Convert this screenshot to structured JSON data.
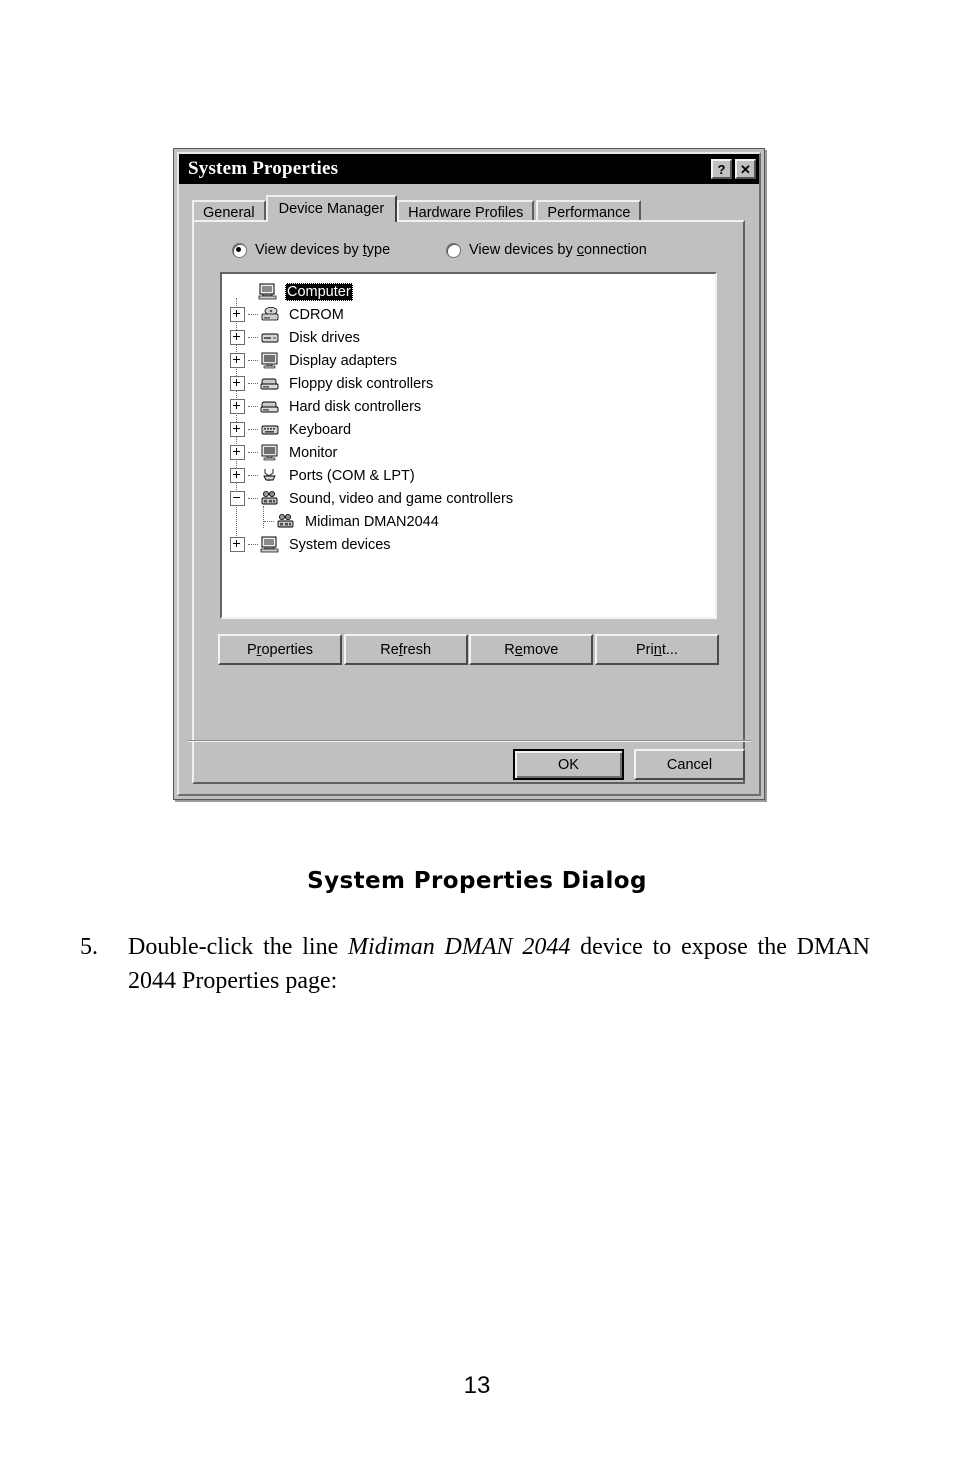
{
  "page": {
    "number": "13",
    "caption": "System Properties Dialog"
  },
  "step": {
    "number": "5.",
    "text_before": "Double-click the line ",
    "text_italic": "Midiman DMAN 2044",
    "text_after": " device to expose the DMAN 2044 Properties page:"
  },
  "dialog": {
    "title": "System Properties",
    "titlebar_buttons": [
      {
        "name": "help-button",
        "glyph": "?"
      },
      {
        "name": "close-button",
        "glyph": "✕"
      }
    ],
    "tabs": [
      {
        "label": "General",
        "active": false
      },
      {
        "label": "Device Manager",
        "active": true
      },
      {
        "label": "Hardware Profiles",
        "active": false
      },
      {
        "label": "Performance",
        "active": false
      }
    ],
    "view_options": [
      {
        "label_prefix": "View devices by ",
        "accel": "t",
        "label_suffix": "ype",
        "checked": true
      },
      {
        "label_prefix": "View devices by ",
        "accel": "c",
        "label_suffix": "onnection",
        "checked": false
      }
    ],
    "tree": [
      {
        "label": "Computer",
        "icon": "computer-icon",
        "state": "none",
        "level": 0,
        "selected": true
      },
      {
        "label": "CDROM",
        "icon": "cdrom-icon",
        "state": "collapsed",
        "level": 0,
        "selected": false
      },
      {
        "label": "Disk drives",
        "icon": "disk-icon",
        "state": "collapsed",
        "level": 0,
        "selected": false
      },
      {
        "label": "Display adapters",
        "icon": "display-icon",
        "state": "collapsed",
        "level": 0,
        "selected": false
      },
      {
        "label": "Floppy disk controllers",
        "icon": "floppy-icon",
        "state": "collapsed",
        "level": 0,
        "selected": false
      },
      {
        "label": "Hard disk controllers",
        "icon": "harddisk-icon",
        "state": "collapsed",
        "level": 0,
        "selected": false
      },
      {
        "label": "Keyboard",
        "icon": "keyboard-icon",
        "state": "collapsed",
        "level": 0,
        "selected": false
      },
      {
        "label": "Monitor",
        "icon": "monitor-icon",
        "state": "collapsed",
        "level": 0,
        "selected": false
      },
      {
        "label": "Ports (COM & LPT)",
        "icon": "ports-icon",
        "state": "collapsed",
        "level": 0,
        "selected": false
      },
      {
        "label": "Sound, video and game controllers",
        "icon": "sound-icon",
        "state": "expanded",
        "level": 0,
        "selected": false
      },
      {
        "label": "Midiman DMAN2044",
        "icon": "sound-icon",
        "state": "leaf",
        "level": 1,
        "selected": false
      },
      {
        "label": "System devices",
        "icon": "system-icon",
        "state": "collapsed",
        "level": 0,
        "selected": false
      }
    ],
    "action_buttons": [
      {
        "prefix": "P",
        "accel": "r",
        "suffix": "operties"
      },
      {
        "prefix": "Re",
        "accel": "f",
        "suffix": "resh"
      },
      {
        "prefix": "R",
        "accel": "e",
        "suffix": "move"
      },
      {
        "prefix": "Pri",
        "accel": "n",
        "suffix": "t..."
      }
    ],
    "footer_buttons": [
      {
        "label": "OK",
        "default": true
      },
      {
        "label": "Cancel",
        "default": false
      }
    ]
  },
  "colors": {
    "dialog_face": "#c0c0c0",
    "titlebar": "#000000",
    "tree_background": "#ffffff",
    "selection": "#000000",
    "page_background": "#ffffff"
  }
}
